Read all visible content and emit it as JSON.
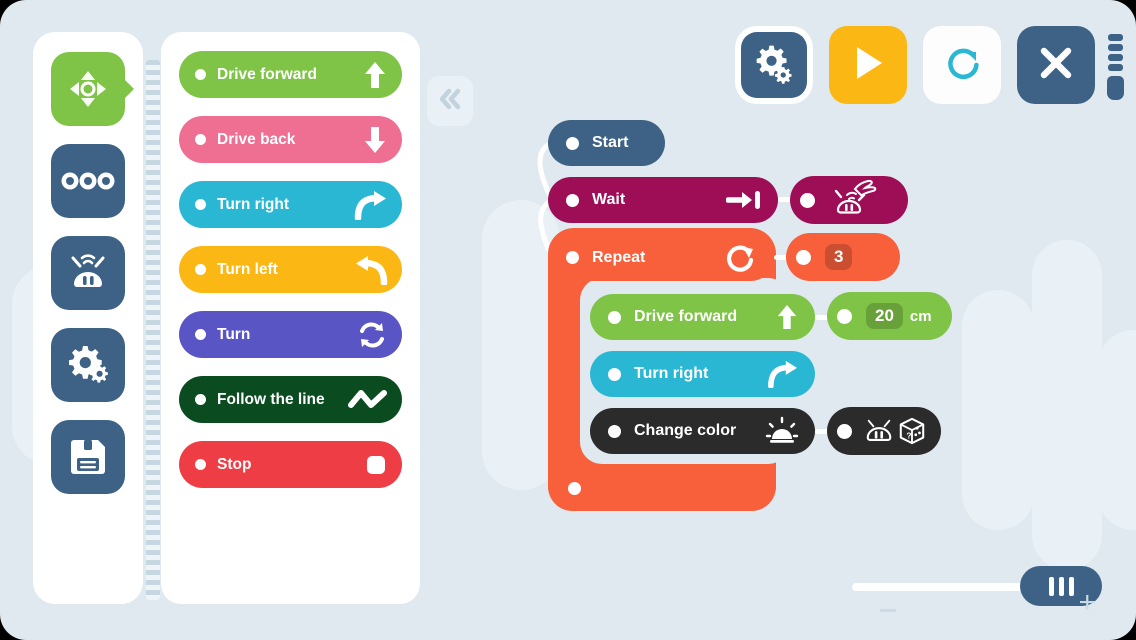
{
  "colors": {
    "canvas_bg": "#dfe9ef",
    "panel_white": "#ffffff",
    "rail_dark": "#3d6285",
    "accent_green": "#7fc447",
    "accent_yellow": "#fbb714",
    "accent_teal": "#2ab7d4"
  },
  "rail": {
    "items": [
      {
        "name": "drive-pad",
        "icon": "dpad-icon",
        "active": true
      },
      {
        "name": "blocks",
        "icon": "three-dots-icon",
        "active": false
      },
      {
        "name": "robot",
        "icon": "robot-icon",
        "active": false
      },
      {
        "name": "settings",
        "icon": "gears-icon",
        "active": false
      },
      {
        "name": "save",
        "icon": "floppy-disk-icon",
        "active": false
      }
    ]
  },
  "palette": {
    "collapse_label": "«",
    "blocks": [
      {
        "label": "Drive forward",
        "color": "#7fc447",
        "icon": "arrow-up-icon"
      },
      {
        "label": "Drive back",
        "color": "#ef6f92",
        "icon": "arrow-down-icon"
      },
      {
        "label": "Turn right",
        "color": "#2ab7d4",
        "icon": "turn-right-icon"
      },
      {
        "label": "Turn left",
        "color": "#fbb714",
        "icon": "turn-left-icon"
      },
      {
        "label": "Turn",
        "color": "#5a55c4",
        "icon": "rotate-icon"
      },
      {
        "label": "Follow the line",
        "color": "#0a4c1f",
        "icon": "wave-line-icon"
      },
      {
        "label": "Stop",
        "color": "#ef3d46",
        "icon": "stop-square-icon"
      }
    ]
  },
  "toolbar": {
    "buttons": [
      {
        "name": "settings-button",
        "icon": "gears-icon",
        "style": "ring-dark"
      },
      {
        "name": "run-button",
        "icon": "play-icon",
        "style": "yellow"
      },
      {
        "name": "reset-button",
        "icon": "refresh-icon",
        "style": "white"
      },
      {
        "name": "close-button",
        "icon": "close-x-icon",
        "style": "dark"
      }
    ],
    "battery": {
      "name": "battery-indicator",
      "segments": 4
    }
  },
  "program": {
    "blocks": [
      {
        "id": "start",
        "label": "Start",
        "color": "#3d6285",
        "icon": null,
        "param": null
      },
      {
        "id": "wait",
        "label": "Wait",
        "color": "#9e0e56",
        "icon": "arrow-to-bar-icon",
        "param": {
          "icon": "hand-tap-robot-icon",
          "value": null,
          "unit": null,
          "color": "#9e0e56"
        }
      },
      {
        "id": "repeat",
        "label": "Repeat",
        "color": "#f8603c",
        "icon": "rotate-cw-icon",
        "param": {
          "icon": null,
          "value": "3",
          "unit": null,
          "color": "#f8603c"
        }
      },
      {
        "id": "drive-forward",
        "label": "Drive forward",
        "color": "#7fc447",
        "icon": "arrow-up-icon",
        "param": {
          "icon": null,
          "value": "20",
          "unit": "cm",
          "color": "#7fc447"
        }
      },
      {
        "id": "turn-right",
        "label": "Turn right",
        "color": "#2ab7d4",
        "icon": "turn-right-icon",
        "param": null
      },
      {
        "id": "change-color",
        "label": "Change color",
        "color": "#2b2b2b",
        "icon": "light-shine-icon",
        "param": {
          "icon": "robot-dice-icon",
          "value": null,
          "unit": null,
          "color": "#2b2b2b"
        }
      }
    ]
  },
  "zoom_control": {
    "name": "zoom-slider",
    "minus_label": "−",
    "plus_label": "+"
  }
}
